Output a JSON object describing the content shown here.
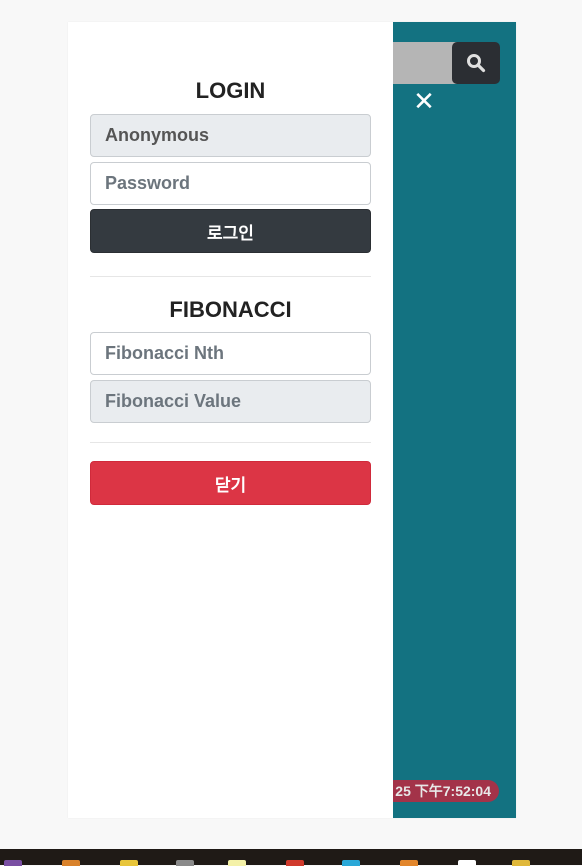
{
  "header": {
    "search_icon": "search-icon",
    "close_icon": "close-icon",
    "close_symbol": "✕"
  },
  "login": {
    "title": "LOGIN",
    "username_value": "Anonymous",
    "password_placeholder": "Password",
    "login_button": "로그인"
  },
  "fibonacci": {
    "title": "FIBONACCI",
    "nth_placeholder": "Fibonacci Nth",
    "value_placeholder": "Fibonacci Value"
  },
  "close_button": "닫기",
  "clock": "25 下午7:52:04",
  "colors": {
    "frame": "#137281",
    "dark_button": "#343a40",
    "danger_button": "#dc3545",
    "clock_badge": "#a33349"
  },
  "taskbar": {
    "icons": [
      "app-icon",
      "app-icon",
      "app-icon",
      "app-icon",
      "app-icon",
      "app-icon",
      "app-icon",
      "app-icon",
      "app-icon",
      "app-icon"
    ]
  }
}
